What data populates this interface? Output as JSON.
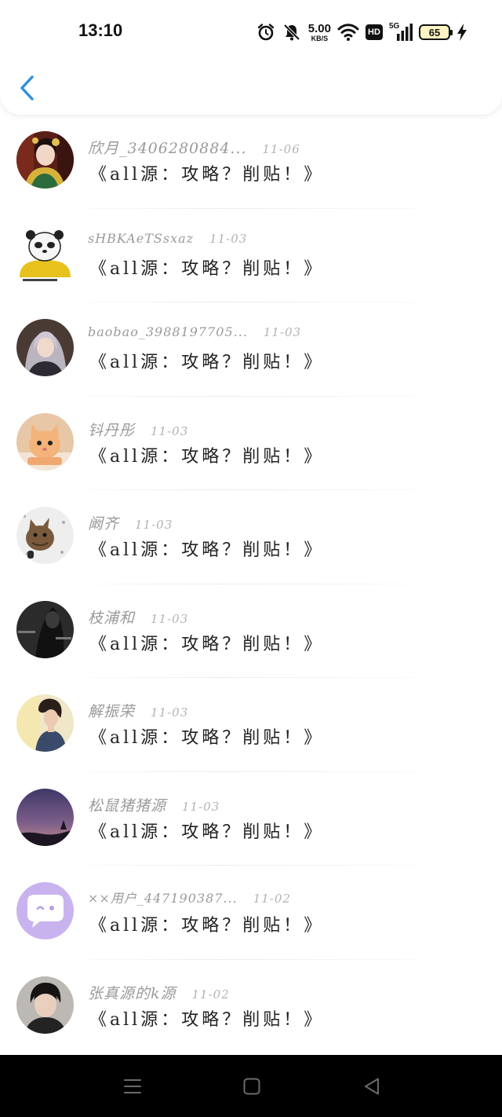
{
  "status_bar": {
    "time": "13:10",
    "net_speed_value": "5.00",
    "net_speed_unit": "KB/S",
    "hd_label": "HD",
    "signal_label": "5G",
    "battery_level": "65",
    "icons": [
      "alarm-icon",
      "mute-icon",
      "wifi-icon",
      "hd-icon",
      "signal-5g-icon",
      "battery-icon",
      "charging-icon"
    ]
  },
  "nav": {
    "back_icon": "chevron-left-icon",
    "accent_color": "#2f8fe0"
  },
  "list": {
    "items": [
      {
        "username": "欣月_3406280884...",
        "date": "11-06",
        "message": "《all源：攻略？削贴！》",
        "avatar": "avatar-photo-woman-red"
      },
      {
        "username": "sHBKAeTSsxaz",
        "date": "11-03",
        "message": "《all源：攻略？削贴！》",
        "avatar": "avatar-panda-meme"
      },
      {
        "username": "baobao_3988197705...",
        "date": "11-03",
        "message": "《all源：攻略？削贴！》",
        "avatar": "avatar-photo-girl"
      },
      {
        "username": "钭丹彤",
        "date": "11-03",
        "message": "《all源：攻略？削贴！》",
        "avatar": "avatar-kitten"
      },
      {
        "username": "阚齐",
        "date": "11-03",
        "message": "《all源：攻略？削贴！》",
        "avatar": "avatar-cat"
      },
      {
        "username": "枝浦和",
        "date": "11-03",
        "message": "《all源：攻略？削贴！》",
        "avatar": "avatar-dark-photo"
      },
      {
        "username": "解振荣",
        "date": "11-03",
        "message": "《all源：攻略？削贴！》",
        "avatar": "avatar-photo-woman"
      },
      {
        "username": "松鼠猪猪源",
        "date": "11-03",
        "message": "《all源：攻略？削贴！》",
        "avatar": "avatar-sunset"
      },
      {
        "username": "××用户_447190387...",
        "date": "11-02",
        "message": "《all源：攻略？削贴！》",
        "avatar": "avatar-chat-bubble"
      },
      {
        "username": "张真源的k源",
        "date": "11-02",
        "message": "《all源：攻略？削贴！》",
        "avatar": "avatar-photo-boy"
      }
    ]
  },
  "system_nav": {
    "buttons": [
      "menu-icon",
      "home-icon",
      "back-triangle-icon"
    ]
  }
}
